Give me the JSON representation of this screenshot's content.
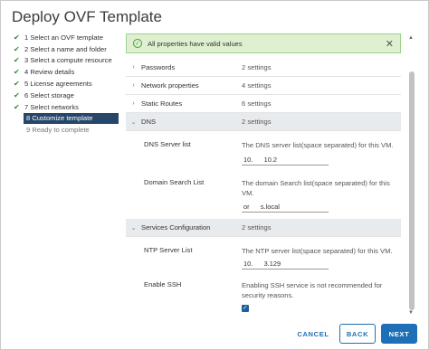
{
  "window": {
    "title": "Deploy OVF Template"
  },
  "steps": [
    {
      "label": "1 Select an OVF template",
      "state": "done"
    },
    {
      "label": "2 Select a name and folder",
      "state": "done"
    },
    {
      "label": "3 Select a compute resource",
      "state": "done"
    },
    {
      "label": "4 Review details",
      "state": "done"
    },
    {
      "label": "5 License agreements",
      "state": "done"
    },
    {
      "label": "6 Select storage",
      "state": "done"
    },
    {
      "label": "7 Select networks",
      "state": "done"
    },
    {
      "label": "8 Customize template",
      "state": "active"
    },
    {
      "label": "9 Ready to complete",
      "state": "pending"
    }
  ],
  "alert": {
    "message": "All properties have valid values",
    "close": "✕",
    "icon": "✓"
  },
  "sections": {
    "passwords": {
      "name": "Passwords",
      "value": "2 settings"
    },
    "network": {
      "name": "Network properties",
      "value": "4 settings"
    },
    "routes": {
      "name": "Static Routes",
      "value": "6 settings"
    },
    "dns": {
      "name": "DNS",
      "value": "2 settings",
      "server": {
        "label": "DNS Server list",
        "desc": "The DNS server list(space separated) for this VM.",
        "value": "10.      10.2"
      },
      "domain": {
        "label": "Domain Search List",
        "desc": "The domain Search list(space separated) for this VM.",
        "value": "or      s.local"
      }
    },
    "services": {
      "name": "Services Configuration",
      "value": "2 settings",
      "ntp": {
        "label": "NTP Server List",
        "desc": "The NTP server list(space separated) for this VM.",
        "value": "10.      3.129"
      },
      "ssh": {
        "label": "Enable SSH",
        "desc": "Enabling SSH service is not recommended for security reasons.",
        "checked": "✓"
      }
    }
  },
  "footer": {
    "cancel": "CANCEL",
    "back": "BACK",
    "next": "NEXT"
  },
  "colors": {
    "active_step": "#26476a",
    "primary": "#1d6fb8",
    "alert_bg": "#dff0d0",
    "check": "#2e8b2e"
  }
}
